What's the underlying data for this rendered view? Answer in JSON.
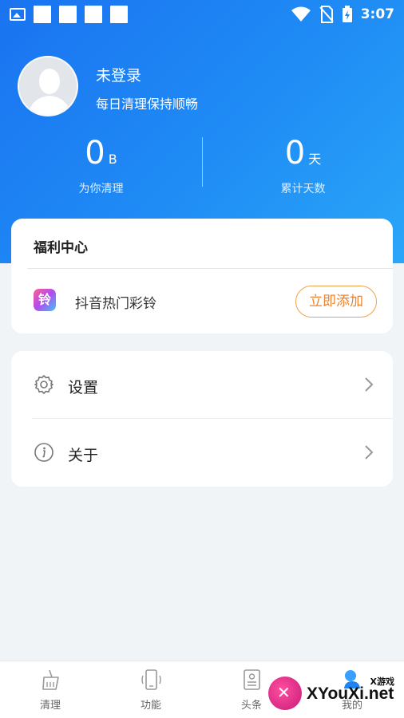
{
  "status_bar": {
    "time": "3:07"
  },
  "profile": {
    "name": "未登录",
    "subtitle": "每日清理保持顺畅"
  },
  "stats": [
    {
      "value": "0",
      "unit": "B",
      "label": "为你清理"
    },
    {
      "value": "0",
      "unit": "天",
      "label": "累计天数"
    }
  ],
  "welfare": {
    "title": "福利中心",
    "item_icon_char": "铃",
    "item_label": "抖音热门彩铃",
    "button_label": "立即添加"
  },
  "menu": [
    {
      "label": "设置",
      "icon": "gear-icon"
    },
    {
      "label": "关于",
      "icon": "info-icon"
    }
  ],
  "bottom_nav": [
    {
      "label": "清理",
      "icon": "broom-icon"
    },
    {
      "label": "功能",
      "icon": "phone-icon"
    },
    {
      "label": "头条",
      "icon": "news-icon"
    },
    {
      "label": "我的",
      "icon": "profile-icon"
    }
  ],
  "watermark": {
    "small": "X游戏",
    "big": "XYouXi.net"
  },
  "colors": {
    "header_gradient_start": "#1a73f0",
    "header_gradient_end": "#2aa6f8",
    "accent_orange": "#f0822d",
    "page_bg": "#f1f4f6"
  }
}
